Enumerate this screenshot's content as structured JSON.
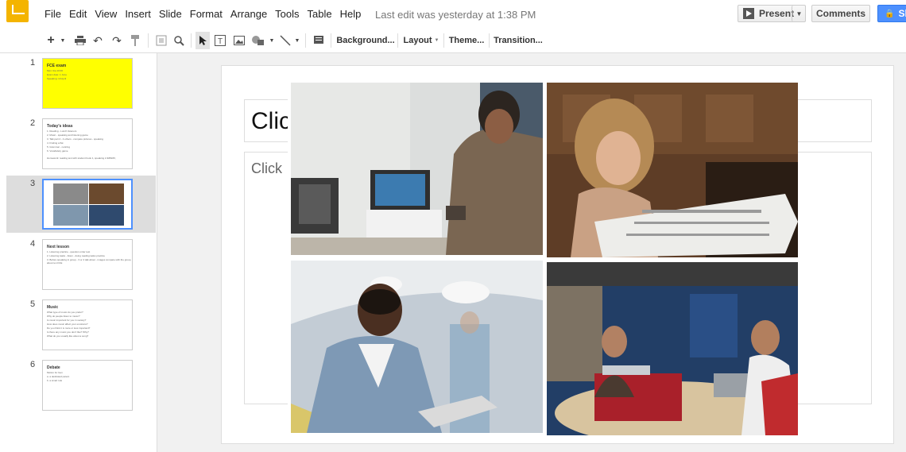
{
  "menubar": {
    "items": [
      "File",
      "Edit",
      "View",
      "Insert",
      "Slide",
      "Format",
      "Arrange",
      "Tools",
      "Table",
      "Help"
    ],
    "last_edit": "Last edit was yesterday at 1:38 PM",
    "present_label": "Present",
    "comments_label": "Comments",
    "share_label": "Sh"
  },
  "toolbar": {
    "background_label": "Background...",
    "layout_label": "Layout",
    "theme_label": "Theme...",
    "transition_label": "Transition..."
  },
  "slides": [
    {
      "num": "1",
      "title": "FCE exam",
      "lines": [
        "Mon: tba 10:00",
        "Exam date: 1 June",
        "Speaking: 10 April"
      ],
      "style": "yellow"
    },
    {
      "num": "2",
      "title": "Today's ideas",
      "lines": [
        "1. Reading - Lunch listeners",
        "2. Music - speaking and listening game",
        "3. Talk part 2 - 4 others - compare pictures - speaking",
        "4. Finding a flat",
        "5. Grammar - noticing",
        "6. Vocabulary game"
      ],
      "footer": "Homework: reading text with student book 1, speaking 2 &#8226;"
    },
    {
      "num": "3",
      "title": "",
      "lines": [],
      "style": "collage"
    },
    {
      "num": "4",
      "title": "Next lesson",
      "lines": [
        "1. Listening practice - question order test",
        "2. Listening tasks - listen - doing reading tasks practice",
        "3. Before speaking in group - 3 or 4 talk about - images compare with the group, about ten FCE"
      ]
    },
    {
      "num": "5",
      "title": "Music",
      "lines": [
        "What type of music do you prefer?",
        "Why do people listen to music?",
        "Is music important for you in society?",
        "How does music affect your emotions?",
        "Do you think it is more or less important?",
        "Is there any music you don't like? Why?",
        "What do you usually like about a song?"
      ]
    },
    {
      "num": "6",
      "title": "Debate",
      "lines": [
        "Motion for Gen",
        "a. a dedicated parent",
        "b. a smart role"
      ]
    }
  ],
  "main": {
    "title_placeholder": "Clic",
    "body_placeholder": "Click"
  },
  "colors": {
    "accent": "#4d90fe",
    "logo": "#f4b400",
    "highlight_slide": "#ffff00"
  }
}
